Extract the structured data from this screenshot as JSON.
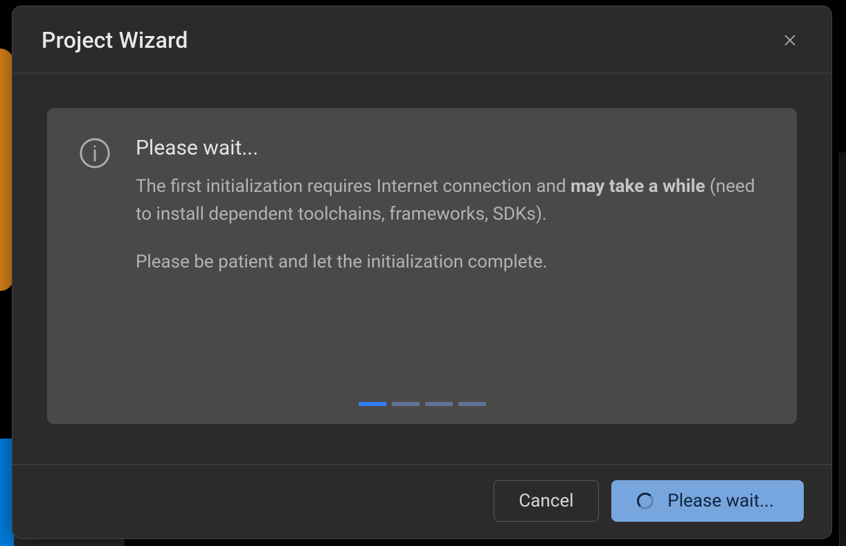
{
  "modal": {
    "title": "Project Wizard"
  },
  "info": {
    "heading": "Please wait...",
    "line1_pre": "The first initialization requires Internet connection and ",
    "line1_strong": "may take a while",
    "line1_post": " (need to install dependent toolchains, frameworks, SDKs).",
    "line2": "Please be patient and let the initialization complete."
  },
  "progress": {
    "steps": 4,
    "active": 1
  },
  "footer": {
    "cancel": "Cancel",
    "primary": "Please wait..."
  }
}
